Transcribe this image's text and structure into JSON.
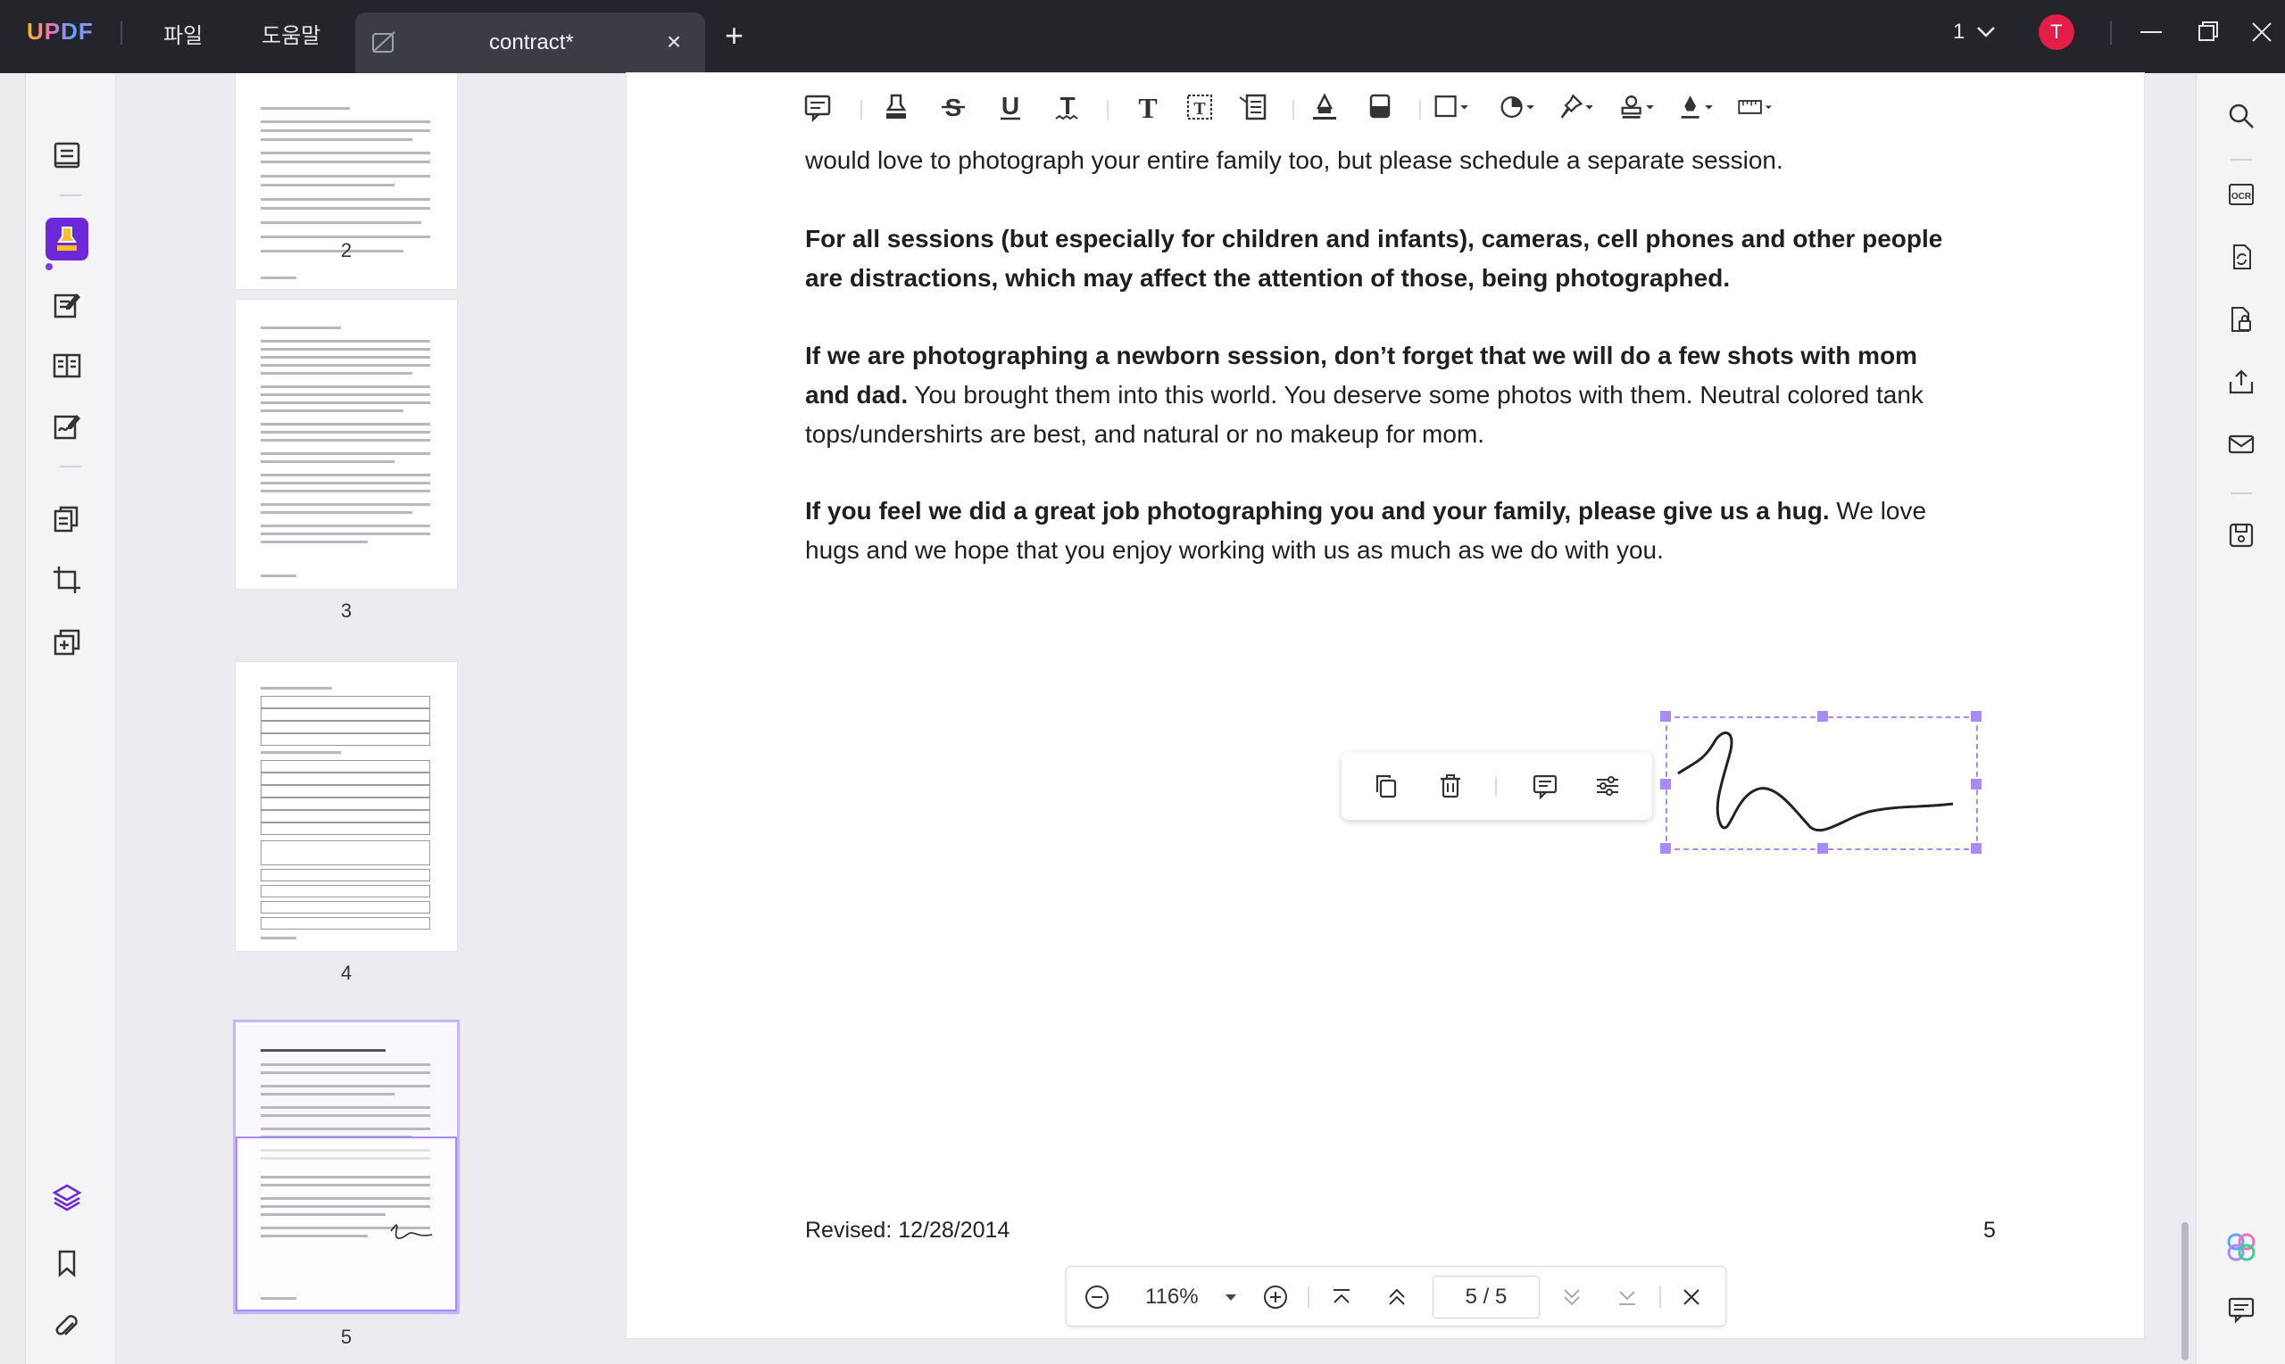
{
  "app": {
    "logo": "UPDF",
    "menu": [
      "파일",
      "도움말"
    ],
    "tab_title": "contract*",
    "page_count_label": "1",
    "avatar_letter": "T"
  },
  "colors": {
    "accent": "#7c3aed",
    "selection": "#a78bfa",
    "avatar": "#e11d48",
    "titlebar": "#24252b"
  },
  "left_toolbar": {
    "icons": [
      "reader-icon",
      "comment-highlighter-icon",
      "edit-pdf-icon",
      "form-icon",
      "sign-icon",
      "organize-pages-icon",
      "crop-icon",
      "page-tools-icon",
      "layers-icon",
      "bookmark-icon",
      "attachment-icon"
    ]
  },
  "thumbnails": [
    {
      "label": "2"
    },
    {
      "label": "3"
    },
    {
      "label": "4"
    },
    {
      "label": "5"
    }
  ],
  "annotation_toolbar": {
    "icons": [
      "sticky-note-icon",
      "highlight-icon",
      "strikethrough-icon",
      "underline-icon",
      "squiggly-icon",
      "text-icon",
      "textbox-icon",
      "callout-icon",
      "pencil-icon",
      "eraser-icon",
      "shape-icon",
      "sticker-icon",
      "pin-icon",
      "stamp-icon",
      "signature-icon",
      "measure-icon"
    ]
  },
  "document": {
    "paragraphs": [
      {
        "bold": "",
        "normal": "would love to photograph your entire family too, but please schedule a separate session."
      },
      {
        "bold": "For all sessions (but especially for children and infants), cameras, cell phones and other people are distractions, which may affect the attention of those, being photographed.",
        "normal": ""
      },
      {
        "bold": "If we are photographing a newborn session, don’t forget that we will do a few shots with mom and dad.",
        "normal": " You brought them into this world. You deserve some photos with them. Neutral colored tank tops/undershirts are best, and natural or no makeup for mom."
      },
      {
        "bold": "If you feel we did a great job photographing you and your family, please give us a hug.",
        "normal": " We love hugs and we hope that you enjoy working with us as much as we do with you."
      }
    ],
    "footer_left": "Revised: 12/28/2014",
    "footer_right": "5"
  },
  "context_menu": {
    "icons": [
      "copy-icon",
      "delete-icon",
      "comment-icon",
      "properties-icon"
    ]
  },
  "navbar": {
    "zoom": "116%",
    "page_current": "5",
    "page_total": "5",
    "page_label": "5 / 5"
  },
  "right_toolbar": {
    "icons": [
      "search-icon",
      "ocr-icon",
      "convert-icon",
      "protect-icon",
      "share-icon",
      "email-icon",
      "save-icon",
      "ai-assistant-icon",
      "comment-list-icon"
    ]
  }
}
